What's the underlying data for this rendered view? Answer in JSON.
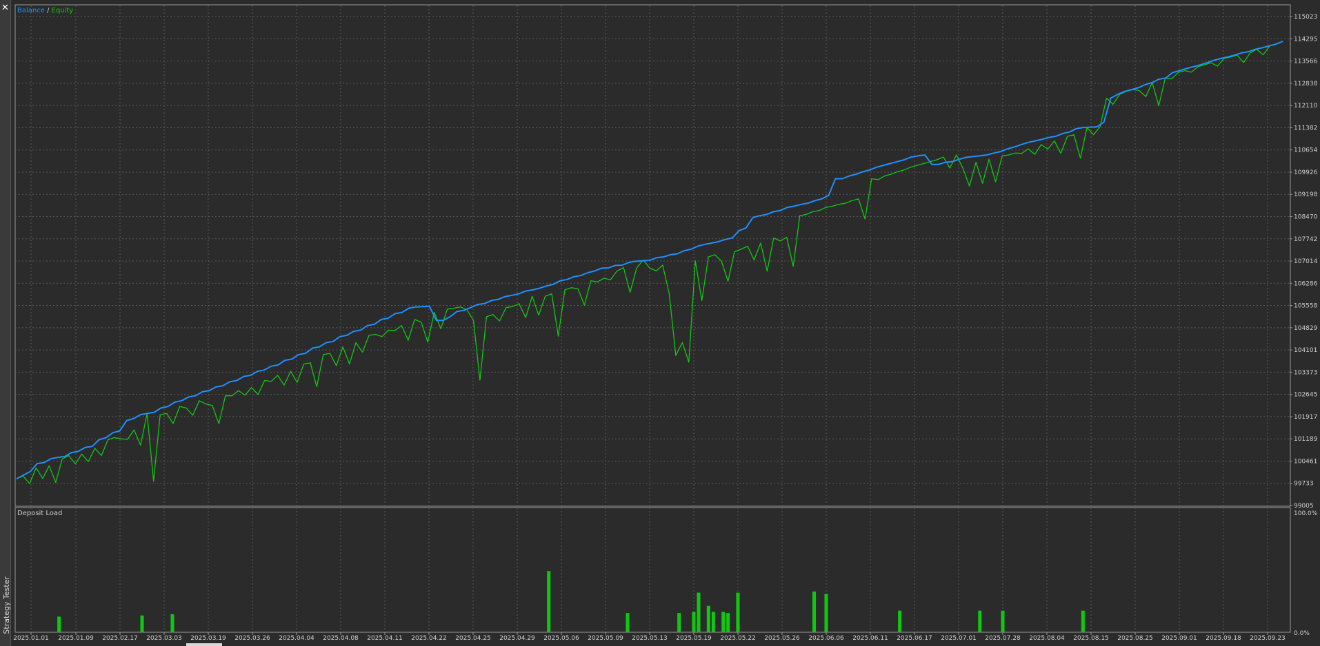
{
  "panel_title": "Strategy Tester",
  "legend": {
    "balance": "Balance",
    "separator": "/",
    "equity": "Equity"
  },
  "deposit_title": "Deposit Load",
  "colors": {
    "balance": "#1e90ff",
    "equity": "#11c811",
    "bars": "#11c811",
    "grid": "#5a5a5a",
    "background": "#2b2b2b"
  },
  "chart_data": [
    {
      "type": "line",
      "title": "",
      "legend": [
        "Balance",
        "Equity"
      ],
      "grid": true,
      "y_ticks": [
        "115023",
        "114295",
        "113566",
        "112838",
        "112110",
        "111382",
        "110654",
        "109926",
        "109198",
        "108470",
        "107742",
        "107014",
        "106286",
        "105558",
        "104829",
        "104101",
        "103373",
        "102645",
        "101917",
        "101189",
        "100461",
        "99733",
        "99005"
      ],
      "ylim": [
        99005,
        115385
      ],
      "x_ticks": [
        "2025.01.01",
        "2025.01.09",
        "2025.02.17",
        "2025.03.03",
        "2025.03.19",
        "2025.03.26",
        "2025.04.04",
        "2025.04.08",
        "2025.04.11",
        "2025.04.22",
        "2025.04.25",
        "2025.04.29",
        "2025.05.06",
        "2025.05.09",
        "2025.05.13",
        "2025.05.19",
        "2025.05.22",
        "2025.05.26",
        "2025.06.06",
        "2025.06.11",
        "2025.06.17",
        "2025.07.01",
        "2025.07.28",
        "2025.08.04",
        "2025.08.15",
        "2025.08.25",
        "2025.09.01",
        "2025.09.18",
        "2025.09.23"
      ],
      "series": [
        {
          "name": "Balance",
          "values": [
            99880,
            100000,
            100120,
            100380,
            100410,
            100540,
            100580,
            100610,
            100740,
            100780,
            100910,
            100940,
            101160,
            101230,
            101390,
            101450,
            101790,
            101850,
            101980,
            102020,
            102060,
            102200,
            102250,
            102390,
            102440,
            102560,
            102600,
            102730,
            102770,
            102890,
            102930,
            103060,
            103100,
            103230,
            103270,
            103400,
            103440,
            103570,
            103610,
            103760,
            103800,
            103950,
            103990,
            104160,
            104200,
            104340,
            104380,
            104540,
            104580,
            104710,
            104750,
            104900,
            104940,
            105100,
            105140,
            105290,
            105330,
            105470,
            105510,
            105520,
            105530,
            105070,
            105070,
            105190,
            105360,
            105400,
            105490,
            105590,
            105620,
            105720,
            105760,
            105850,
            105890,
            105940,
            106030,
            106070,
            106120,
            106200,
            106250,
            106370,
            106410,
            106500,
            106540,
            106630,
            106690,
            106780,
            106790,
            106870,
            106880,
            106970,
            107010,
            107020,
            107040,
            107120,
            107150,
            107220,
            107250,
            107350,
            107400,
            107500,
            107560,
            107600,
            107650,
            107720,
            107770,
            108010,
            108100,
            108440,
            108500,
            108540,
            108630,
            108670,
            108770,
            108810,
            108870,
            108910,
            108990,
            109050,
            109160,
            109710,
            109710,
            109800,
            109860,
            109940,
            110000,
            110090,
            110150,
            110210,
            110270,
            110330,
            110420,
            110460,
            110490,
            110180,
            110180,
            110250,
            110270,
            110350,
            110410,
            110440,
            110460,
            110490,
            110550,
            110600,
            110690,
            110750,
            110830,
            110900,
            110950,
            111000,
            111060,
            111100,
            111190,
            111240,
            111350,
            111390,
            111400,
            111410,
            111560,
            112350,
            112470,
            112570,
            112630,
            112690,
            112790,
            112860,
            112970,
            113010,
            113190,
            113250,
            113320,
            113380,
            113440,
            113510,
            113590,
            113650,
            113700,
            113760,
            113830,
            113870,
            113950,
            114000,
            114060,
            114120,
            114210
          ]
        },
        {
          "name": "Equity",
          "values": [
            99880,
            99970,
            99720,
            100240,
            99890,
            100310,
            99760,
            100530,
            100640,
            100370,
            100690,
            100440,
            100880,
            100640,
            101160,
            101230,
            101190,
            101170,
            101480,
            100980,
            102020,
            99800,
            101980,
            102020,
            101690,
            102250,
            102200,
            101960,
            102440,
            102330,
            102280,
            101680,
            102600,
            102600,
            102770,
            102620,
            102870,
            102640,
            103100,
            103070,
            103270,
            102950,
            103400,
            103040,
            103640,
            103680,
            102900,
            103950,
            103990,
            103590,
            104200,
            103640,
            104340,
            104030,
            104580,
            104610,
            104540,
            104750,
            104740,
            104900,
            104420,
            105100,
            105010,
            104360,
            105330,
            104800,
            105440,
            105470,
            105510,
            105420,
            105070,
            103110,
            105190,
            105260,
            105050,
            105490,
            105520,
            105620,
            105160,
            105860,
            105240,
            105860,
            105940,
            104550,
            106070,
            106140,
            106110,
            105570,
            106370,
            106330,
            106450,
            106400,
            106690,
            106800,
            105990,
            106780,
            107050,
            106790,
            106690,
            106880,
            105940,
            103920,
            104340,
            103700,
            107020,
            105720,
            107150,
            107220,
            107010,
            106350,
            107320,
            107400,
            107500,
            107050,
            107600,
            106680,
            107770,
            107670,
            107790,
            106840,
            108500,
            108540,
            108630,
            108670,
            108770,
            108810,
            108870,
            108910,
            108990,
            109050,
            108390,
            109710,
            109680,
            109800,
            109860,
            109940,
            110000,
            110090,
            110150,
            110210,
            110270,
            110330,
            110420,
            110060,
            110490,
            110050,
            109470,
            110250,
            109560,
            110350,
            109610,
            110460,
            110490,
            110550,
            110540,
            110690,
            110510,
            110830,
            110680,
            110950,
            110540,
            111100,
            111150,
            110380,
            111390,
            111150,
            111410,
            112350,
            112150,
            112470,
            112570,
            112630,
            112600,
            112400,
            112860,
            112100,
            113010,
            112990,
            113190,
            113250,
            113200,
            113380,
            113440,
            113510,
            113400,
            113650,
            113700,
            113760,
            113520,
            113830,
            113950,
            113770,
            114060,
            114120,
            114210
          ]
        }
      ]
    },
    {
      "type": "bar",
      "title": "Deposit Load",
      "y_ticks": [
        "100.0%",
        "0.0%"
      ],
      "ylim": [
        0,
        100
      ],
      "x_ticks": [
        "2025.01.01",
        "2025.01.09",
        "2025.02.17",
        "2025.03.03",
        "2025.03.19",
        "2025.03.26",
        "2025.04.04",
        "2025.04.08",
        "2025.04.11",
        "2025.04.22",
        "2025.04.25",
        "2025.04.29",
        "2025.05.06",
        "2025.05.09",
        "2025.05.13",
        "2025.05.19",
        "2025.05.22",
        "2025.05.26",
        "2025.06.06",
        "2025.06.11",
        "2025.06.17",
        "2025.07.01",
        "2025.07.28",
        "2025.08.04",
        "2025.08.15",
        "2025.08.25",
        "2025.09.01",
        "2025.09.18",
        "2025.09.23"
      ],
      "bars": [
        {
          "x": "2025.01.06",
          "value": 13
        },
        {
          "x": "2025.02.24",
          "value": 14
        },
        {
          "x": "2025.03.06",
          "value": 15
        },
        {
          "x": "2025.05.04",
          "value": 51
        },
        {
          "x": "2025.05.11",
          "value": 16
        },
        {
          "x": "2025.05.17",
          "value": 16
        },
        {
          "x": "2025.05.19",
          "value": 17
        },
        {
          "x": "2025.05.19",
          "value": 33
        },
        {
          "x": "2025.05.20",
          "value": 22
        },
        {
          "x": "2025.05.20",
          "value": 17
        },
        {
          "x": "2025.05.21",
          "value": 17
        },
        {
          "x": "2025.05.21",
          "value": 16
        },
        {
          "x": "2025.05.22",
          "value": 33
        },
        {
          "x": "2025.06.03",
          "value": 34
        },
        {
          "x": "2025.06.06",
          "value": 32
        },
        {
          "x": "2025.06.15",
          "value": 18
        },
        {
          "x": "2025.07.14",
          "value": 18
        },
        {
          "x": "2025.07.28",
          "value": 18
        },
        {
          "x": "2025.08.13",
          "value": 18
        }
      ]
    }
  ]
}
